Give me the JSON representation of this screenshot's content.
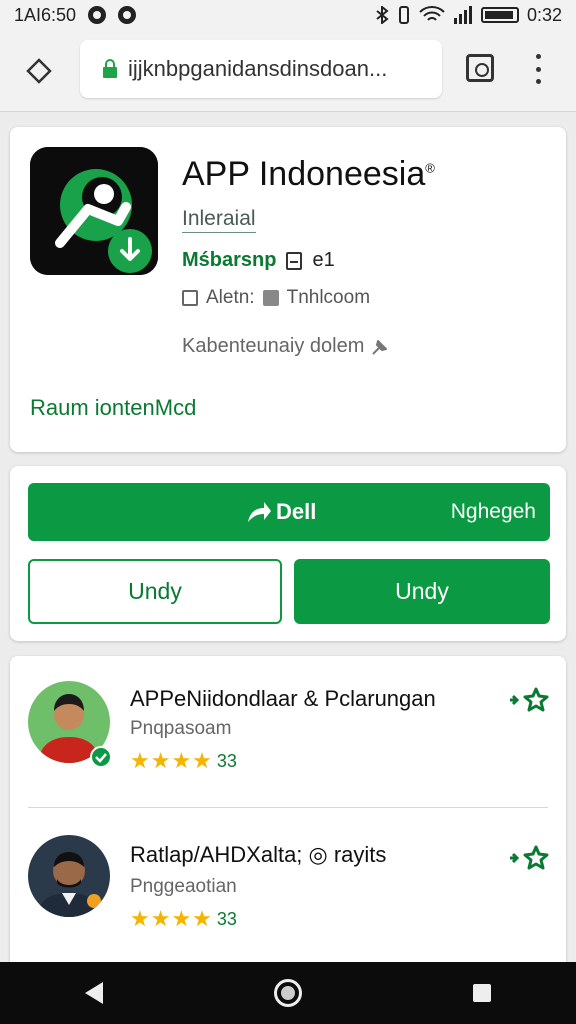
{
  "status_bar": {
    "time_left": "1AI6:50",
    "time_right": "0:32"
  },
  "browser": {
    "url": "ijjknbpganidansdinsdoan...",
    "icons": [
      "home-icon",
      "lock-icon",
      "tabs-icon",
      "overflow-menu-icon"
    ]
  },
  "app": {
    "title": "APP Indoneesia",
    "title_mark": "®",
    "category": "Inleraial",
    "developer": "Mśbarsnp",
    "developer_count": "e1",
    "meta_label": "Aletn:",
    "meta_value": "Tnhlcoom",
    "description": "Kabenteunaiy dolem",
    "link": "Raum iontenMcd"
  },
  "actions": {
    "primary_label": "Dell",
    "primary_right": "Nghegeh",
    "secondary_label": "Undy",
    "tertiary_label": "Undy"
  },
  "reviews": [
    {
      "name": "APPeNiidondlaar & Pclarungan",
      "subtitle": "Pnqpasoam",
      "stars": "★★★★",
      "count": "33"
    },
    {
      "name": "Ratlap/AHDXalta; ◎ rayits",
      "subtitle": "Pnggeaotian",
      "stars": "★★★★",
      "count": "33"
    }
  ],
  "colors": {
    "brand_green": "#0b9a43",
    "text_green": "#0a7a33",
    "star_yellow": "#f4b400"
  }
}
